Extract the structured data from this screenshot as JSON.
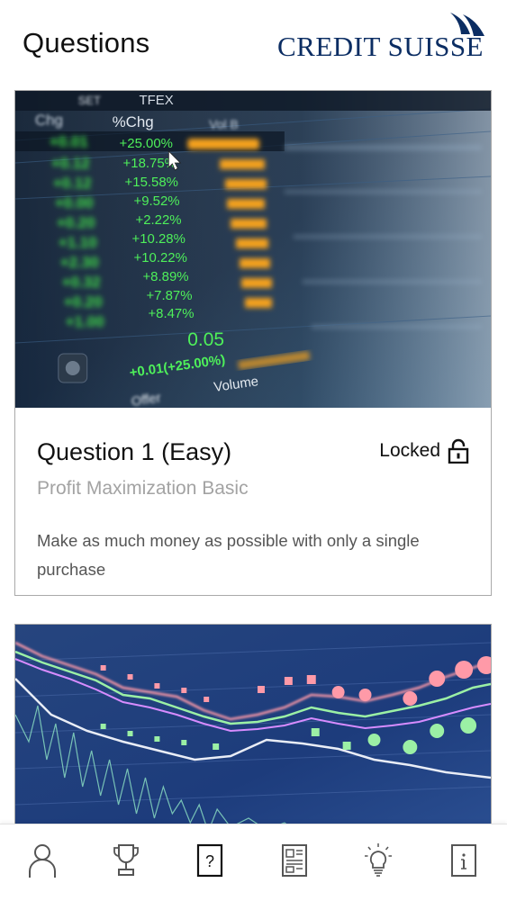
{
  "header": {
    "title": "Questions",
    "logo_text": "CREDIT SUISSE"
  },
  "questions": [
    {
      "title": "Question 1 (Easy)",
      "status": "Locked",
      "subtitle": "Profit Maximization Basic",
      "description": "Make as much money as possible with only a single purchase",
      "image": {
        "tickers": [
          "SET",
          "TFEX"
        ],
        "headers": [
          "Chg",
          "%Chg",
          "Vol B"
        ],
        "changes": [
          "+0.01",
          "+0.12",
          "+0.12",
          "+0.00",
          "+0.20",
          "+1.10",
          "+2.30",
          "+0.32",
          "+0.20",
          "+1.00"
        ],
        "pct_changes": [
          "+25.00%",
          "+18.75%",
          "+15.58%",
          "+9.52%",
          "+2.22%",
          "+10.28%",
          "+10.22%",
          "+8.89%",
          "+7.87%",
          "+8.47%"
        ],
        "bottom_value": "0.05",
        "bottom_change": "+0.01(+25.00%)",
        "volume_label": "Volume",
        "offer_label": "Offer"
      }
    },
    {
      "image": {
        "kind": "line-chart"
      }
    }
  ],
  "tabbar": {
    "items": [
      {
        "name": "profile",
        "icon": "person-icon"
      },
      {
        "name": "leaderboard",
        "icon": "trophy-icon"
      },
      {
        "name": "questions",
        "icon": "question-icon",
        "active": true
      },
      {
        "name": "news",
        "icon": "newspaper-icon"
      },
      {
        "name": "tips",
        "icon": "lightbulb-icon"
      },
      {
        "name": "info",
        "icon": "info-icon"
      }
    ]
  },
  "colors": {
    "logo": "#0b2d63",
    "subtitle": "#a3a3a3",
    "ticker_green": "#3fe046",
    "ticker_orange": "#f5a21a"
  }
}
